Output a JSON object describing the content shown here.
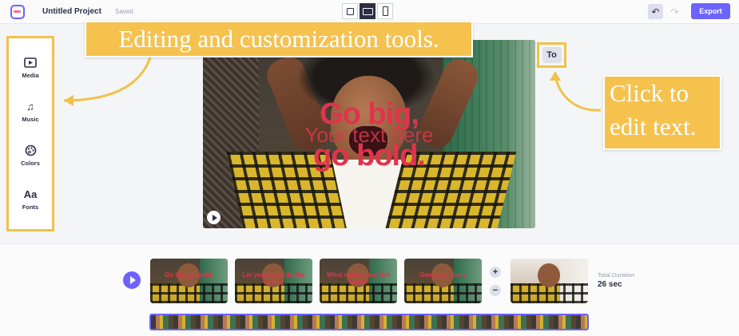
{
  "header": {
    "project_title": "Untitled Project",
    "save_status": "Saved",
    "aspect_ratios": [
      "square",
      "landscape",
      "portrait"
    ],
    "aspect_selected": "landscape",
    "undo_icon": "undo-icon",
    "redo_icon": "redo-icon",
    "export_label": "Export",
    "accent_color": "#6c63ff"
  },
  "sidebar": {
    "items": [
      {
        "label": "Media",
        "icon": "media-icon",
        "glyph": "▶"
      },
      {
        "label": "Music",
        "icon": "music-note-icon",
        "glyph": "♫"
      },
      {
        "label": "Colors",
        "icon": "palette-icon",
        "glyph": "◕"
      },
      {
        "label": "Fonts",
        "icon": "fonts-icon",
        "glyph": "Aa"
      }
    ]
  },
  "callouts": {
    "tools": "Editing and customization tools.",
    "text_line1": "Click to",
    "text_line2": "edit text.",
    "color": "#f5c24e"
  },
  "canvas": {
    "overlay_line1": "Go big,",
    "overlay_line2": "Your text here",
    "overlay_line3": "go bold.",
    "text_color": "#e0344c"
  },
  "text_tool": {
    "label": "To"
  },
  "timeline": {
    "clips": [
      {
        "text": "Go big, go bold."
      },
      {
        "text": "Let your style do the talking"
      },
      {
        "text": "What makes you feel bold?"
      },
      {
        "text": "Own your story"
      },
      {
        "text": ""
      }
    ],
    "add_label": "+",
    "remove_label": "−",
    "total_duration_label": "Total Duration",
    "total_duration_value": "26 sec"
  }
}
